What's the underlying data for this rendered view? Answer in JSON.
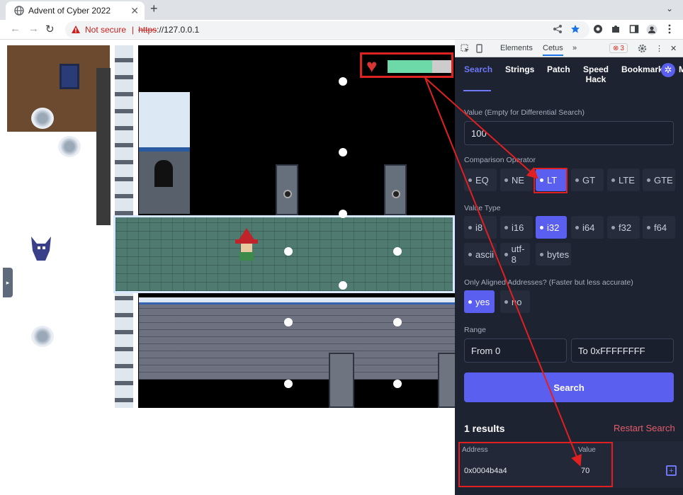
{
  "browser": {
    "tab_title": "Advent of Cyber 2022",
    "tab_close": "✕",
    "new_tab": "+",
    "tab_menu": "⌄",
    "nav": {
      "back": "←",
      "forward": "→",
      "reload": "↻"
    },
    "security_label": "Not secure",
    "separator": "|",
    "url_scheme": "https",
    "url_rest": "://127.0.0.1",
    "toolbar_icons": [
      "share-icon",
      "star-icon",
      "extension-icon",
      "puzzle-icon",
      "sidepanel-icon",
      "profile-icon",
      "menu-icon"
    ]
  },
  "game": {
    "health_fraction": 0.7,
    "sidebar_handle": "▸"
  },
  "devtools": {
    "tabs": [
      "Elements",
      "Cetus"
    ],
    "active_tab": "Cetus",
    "more": "»",
    "error_count": "3",
    "close": "✕",
    "kebab": "⋮",
    "cetus": {
      "nav": [
        {
          "label": "Search"
        },
        {
          "label": "Strings"
        },
        {
          "label": "Patch"
        },
        {
          "label": "Speed Hack"
        },
        {
          "label": "Bookmark"
        },
        {
          "label": "M"
        }
      ],
      "active_nav": "Search",
      "value_label": "Value (Empty for Differential Search)",
      "value": "100",
      "comparison_label": "Comparison Operator",
      "comparison_options": [
        "EQ",
        "NE",
        "LT",
        "GT",
        "LTE",
        "GTE"
      ],
      "comparison_selected": "LT",
      "type_label": "Value Type",
      "type_options": [
        "i8",
        "i16",
        "i32",
        "i64",
        "f32",
        "f64",
        "ascii",
        "utf-8",
        "bytes"
      ],
      "type_selected": "i32",
      "aligned_label": "Only Aligned Addresses? (Faster but less accurate)",
      "aligned_options": [
        "yes",
        "no"
      ],
      "aligned_selected": "yes",
      "range_label": "Range",
      "range_from": "From 0",
      "range_to": "To 0xFFFFFFFF",
      "search_button": "Search",
      "results_count": "1 results",
      "restart_label": "Restart Search",
      "table": {
        "headers": [
          "Address",
          "Value"
        ],
        "rows": [
          {
            "address": "0x0004b4a4",
            "value": "70"
          }
        ]
      }
    }
  },
  "colors": {
    "accent": "#5b5ff0",
    "highlight": "#e02020",
    "restart": "#e35d6a",
    "health": "#6ed9a8"
  }
}
